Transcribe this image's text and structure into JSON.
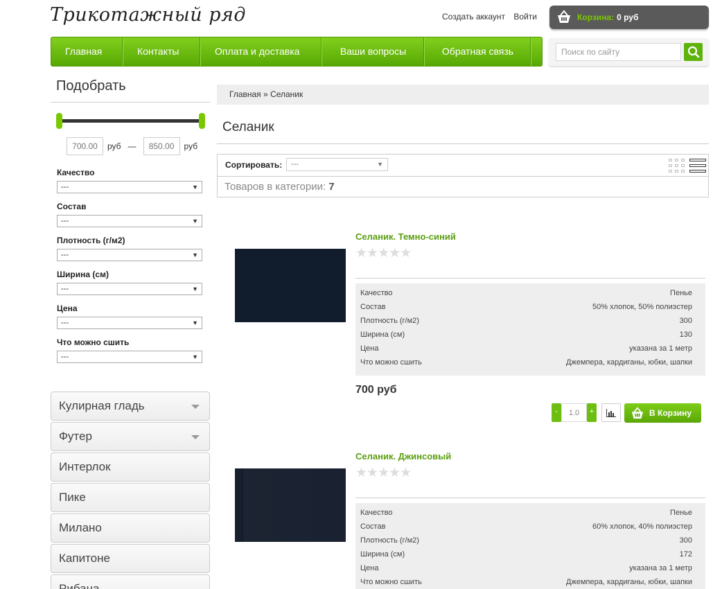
{
  "logo": "Трикотажный ряд",
  "toplinks": {
    "create_account": "Создать аккаунт",
    "login": "Войти"
  },
  "cart": {
    "label": "Корзина:",
    "value": "0 руб",
    "icon": "basket-icon"
  },
  "nav": [
    "Главная",
    "Контакты",
    "Оплата и доставка",
    "Ваши вопросы",
    "Обратная связь"
  ],
  "search": {
    "placeholder": "Поиск по сайту",
    "icon": "search-icon"
  },
  "filter": {
    "title": "Подобрать",
    "price_min": "700.00",
    "price_max": "850.00",
    "currency": "руб",
    "dash": "—",
    "groups": [
      {
        "label": "Качество",
        "value": "---"
      },
      {
        "label": "Состав",
        "value": "---"
      },
      {
        "label": "Плотность (г/м2)",
        "value": "---"
      },
      {
        "label": "Ширина (см)",
        "value": "---"
      },
      {
        "label": "Цена",
        "value": "---"
      },
      {
        "label": "Что можно сшить",
        "value": "---"
      }
    ]
  },
  "categories": [
    "Кулирная гладь",
    "Футер",
    "Интерлок",
    "Пике",
    "Милано",
    "Капитоне",
    "Рибана"
  ],
  "breadcrumb": {
    "home": "Главная",
    "sep": "»",
    "current": "Селаник"
  },
  "category_title": "Селаник",
  "toolbar": {
    "sort_label": "Сортировать:",
    "sort_value": "---",
    "count_label": "Товаров в категории:",
    "count_value": "7"
  },
  "products": [
    {
      "name": "Селаник. Темно-синий",
      "rating": 0,
      "attrs": [
        {
          "k": "Качество",
          "v": "Пенье"
        },
        {
          "k": "Состав",
          "v": "50% хлопок, 50% полиэстер"
        },
        {
          "k": "Плотность (г/м2)",
          "v": "300"
        },
        {
          "k": "Ширина (см)",
          "v": "130"
        },
        {
          "k": "Цена",
          "v": "указана за 1 метр"
        },
        {
          "k": "Что можно сшить",
          "v": "Джемпера, кардиганы, юбки, шапки"
        }
      ],
      "price": "700 руб",
      "qty": "1.0",
      "buy_label": "В Корзину"
    },
    {
      "name": "Селаник. Джинсовый",
      "rating": 0,
      "attrs": [
        {
          "k": "Качество",
          "v": "Пенье"
        },
        {
          "k": "Состав",
          "v": "60% хлопок, 40% полиэстер"
        },
        {
          "k": "Плотность (г/м2)",
          "v": "300"
        },
        {
          "k": "Ширина (см)",
          "v": "172"
        },
        {
          "k": "Цена",
          "v": "указана за 1 метр"
        },
        {
          "k": "Что можно сшить",
          "v": "Джемпера, кардиганы, юбки, шапки"
        }
      ],
      "price": "",
      "qty": "",
      "buy_label": ""
    }
  ],
  "qty_minus": "-",
  "qty_plus": "+",
  "colors": {
    "accent": "#6cbf10",
    "link": "#5a9e10",
    "cart_bg": "#5a5a5a"
  }
}
